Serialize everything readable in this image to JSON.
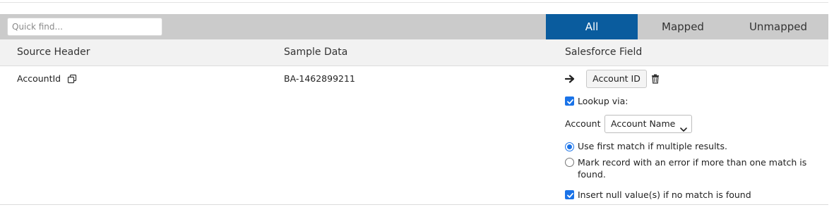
{
  "search": {
    "placeholder": "Quick find..."
  },
  "tabs": [
    {
      "label": "All",
      "active": true
    },
    {
      "label": "Mapped",
      "active": false
    },
    {
      "label": "Unmapped",
      "active": false
    }
  ],
  "columns": [
    "Source Header",
    "Sample Data",
    "Salesforce Field"
  ],
  "row": {
    "source_header": "AccountId",
    "sample_data": "BA-1462899211",
    "mapped_field": "Account ID",
    "lookup_label": "Lookup via:",
    "lookup_checked": true,
    "object_label": "Account",
    "lookup_field": "Account Name",
    "options": [
      {
        "label": "Use first match if multiple results.",
        "selected": true
      },
      {
        "label": "Mark record with an error if more than one match is found.",
        "line1": "Mark record with an error if more than one match is",
        "line2": "found.",
        "selected": false
      }
    ],
    "insert_null_label": "Insert null value(s) if no match is found",
    "insert_null_checked": true
  },
  "colors": {
    "active_tab": "#0a5c9e",
    "checkbox": "#1a73e8",
    "filter_bar": "#cbcbcb"
  },
  "icons": [
    "copy-icon",
    "arrow-right-icon",
    "trash-icon",
    "chevron-down-icon",
    "check-icon"
  ]
}
